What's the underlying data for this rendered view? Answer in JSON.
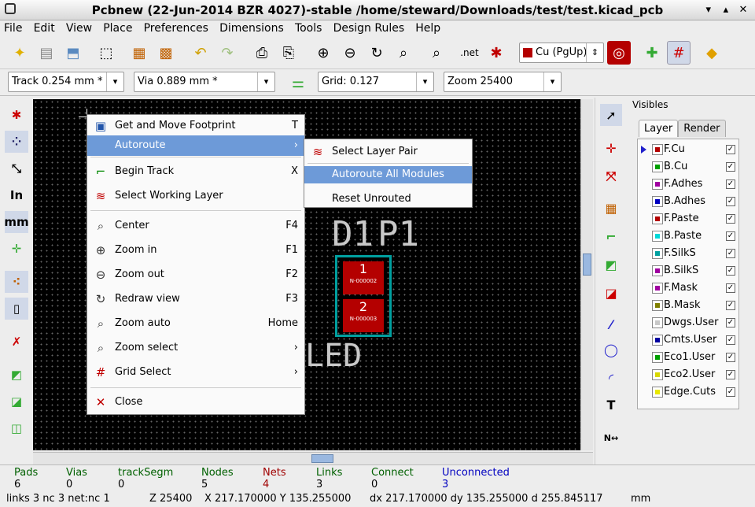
{
  "window": {
    "title": "Pcbnew (22-Jun-2014 BZR 4027)-stable /home/steward/Downloads/test/test.kicad_pcb",
    "buttons": [
      "▾",
      "▴",
      "✕"
    ]
  },
  "menubar": [
    "File",
    "Edit",
    "View",
    "Place",
    "Preferences",
    "Dimensions",
    "Tools",
    "Design Rules",
    "Help"
  ],
  "toolbar": {
    "layer_select": "Cu (PgUp)",
    "icons": [
      "new-board-icon",
      "open-board-icon",
      "save-board-icon",
      "page-settings-icon",
      "module-editor-icon",
      "module-viewer-icon",
      "undo-icon",
      "redo-icon",
      "print-icon",
      "plot-icon",
      "zoom-in-icon",
      "zoom-out-icon",
      "redraw-icon",
      "zoom-fit-icon",
      "find-icon",
      "netlist-icon",
      "drc-icon",
      "layer-pair-icon",
      "mode-footprint-icon",
      "mode-track-icon",
      "autorouter-icon"
    ]
  },
  "auxbar": {
    "track": "Track 0.254 mm *",
    "via": "Via 0.889 mm *",
    "grid": "Grid: 0.127",
    "zoom": "Zoom 25400"
  },
  "context_menu": {
    "items": [
      {
        "label": "Get and Move Footprint",
        "shortcut": "T",
        "icon": "move-footprint-icon"
      },
      {
        "label": "Autoroute",
        "shortcut": "›",
        "icon": "autoroute-icon"
      },
      {
        "label": "Begin Track",
        "shortcut": "X",
        "icon": "begin-track-icon"
      },
      {
        "label": "Select Working Layer",
        "shortcut": "",
        "icon": "select-layer-icon"
      },
      {
        "label": "Center",
        "shortcut": "F4",
        "icon": "center-icon"
      },
      {
        "label": "Zoom in",
        "shortcut": "F1",
        "icon": "zoom-in-icon"
      },
      {
        "label": "Zoom out",
        "shortcut": "F2",
        "icon": "zoom-out-icon"
      },
      {
        "label": "Redraw view",
        "shortcut": "F3",
        "icon": "redraw-icon"
      },
      {
        "label": "Zoom auto",
        "shortcut": "Home",
        "icon": "zoom-auto-icon"
      },
      {
        "label": "Zoom select",
        "shortcut": "›",
        "icon": "zoom-select-icon"
      },
      {
        "label": "Grid Select",
        "shortcut": "›",
        "icon": "grid-select-icon"
      },
      {
        "label": "Close",
        "shortcut": "",
        "icon": "close-icon"
      }
    ]
  },
  "submenu": {
    "items": [
      {
        "label": "Select Layer Pair",
        "icon": "layer-pair-icon"
      },
      {
        "label": "Autoroute All Modules",
        "icon": ""
      },
      {
        "label": "Reset Unrouted",
        "icon": ""
      }
    ]
  },
  "pcb": {
    "ref_d1": "D1",
    "ref_p1": "P1",
    "value": "LED",
    "pad1": "1",
    "pad1_net": "N-000002",
    "pad2": "2",
    "pad2_net": "N-000003"
  },
  "visibles": {
    "title": "Visibles",
    "tabs": [
      "Layer",
      "Render"
    ],
    "layers": [
      {
        "name": "F.Cu",
        "color": "#b40000",
        "checked": "✓"
      },
      {
        "name": "B.Cu",
        "color": "#00a000",
        "checked": "✓"
      },
      {
        "name": "F.Adhes",
        "color": "#a000a0",
        "checked": "✓"
      },
      {
        "name": "B.Adhes",
        "color": "#0000c0",
        "checked": "✓"
      },
      {
        "name": "F.Paste",
        "color": "#b40000",
        "checked": "✓"
      },
      {
        "name": "B.Paste",
        "color": "#00d8d8",
        "checked": "✓"
      },
      {
        "name": "F.SilkS",
        "color": "#00a0a0",
        "checked": "✓"
      },
      {
        "name": "B.SilkS",
        "color": "#a000a0",
        "checked": "✓"
      },
      {
        "name": "F.Mask",
        "color": "#a000a0",
        "checked": "✓"
      },
      {
        "name": "B.Mask",
        "color": "#808000",
        "checked": "✓"
      },
      {
        "name": "Dwgs.User",
        "color": "#c8c8c8",
        "checked": "✓"
      },
      {
        "name": "Cmts.User",
        "color": "#0000a0",
        "checked": "✓"
      },
      {
        "name": "Eco1.User",
        "color": "#00a000",
        "checked": "✓"
      },
      {
        "name": "Eco2.User",
        "color": "#d8d800",
        "checked": "✓"
      },
      {
        "name": "Edge.Cuts",
        "color": "#e8e800",
        "checked": "✓"
      }
    ]
  },
  "status": {
    "pads": {
      "label": "Pads",
      "value": "6"
    },
    "vias": {
      "label": "Vias",
      "value": "0"
    },
    "track": {
      "label": "trackSegm",
      "value": "0"
    },
    "nodes": {
      "label": "Nodes",
      "value": "5"
    },
    "nets": {
      "label": "Nets",
      "value": "4"
    },
    "links": {
      "label": "Links",
      "value": "3"
    },
    "connect": {
      "label": "Connect",
      "value": "0"
    },
    "unconnected": {
      "label": "Unconnected",
      "value": "3"
    }
  },
  "bottom": {
    "links": "links 3 nc 3  net:nc 1",
    "z": "Z 25400",
    "xy": "X 217.170000  Y 135.255000",
    "dxy": "dx 217.170000  dy 135.255000  d 255.845117",
    "units": "mm"
  }
}
